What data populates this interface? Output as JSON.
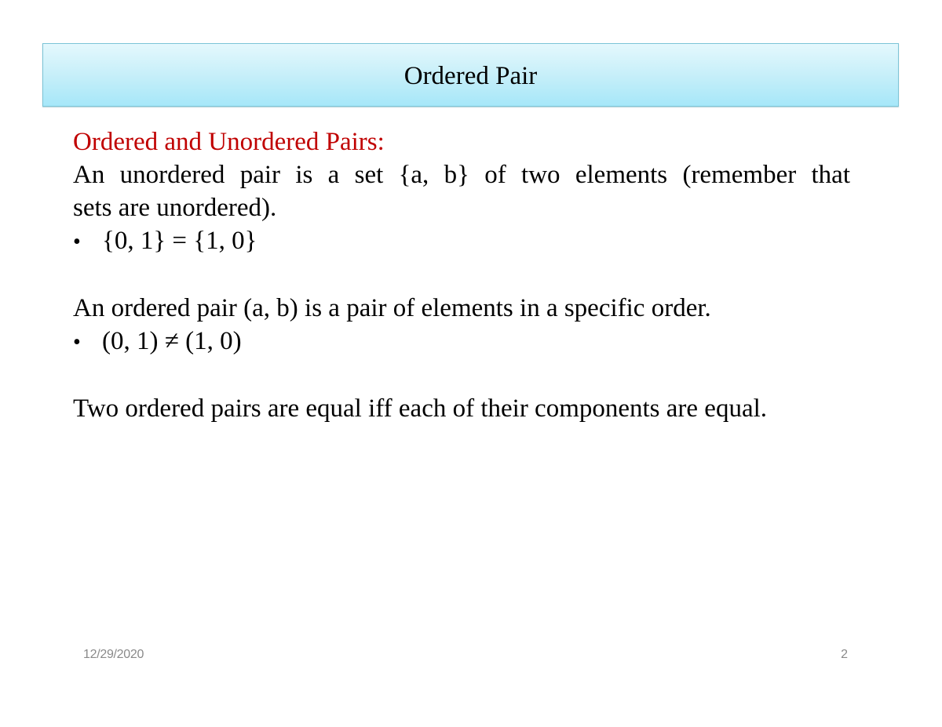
{
  "slide": {
    "title": "Ordered Pair",
    "heading": "Ordered and Unordered Pairs:",
    "paragraph1_line1": "An unordered pair is a set {a, b} of two elements (remember that",
    "paragraph1_line2": "sets are unordered).",
    "bullet1": {
      "marker": "•",
      "text": "{0, 1} = {1, 0}"
    },
    "paragraph2": "An ordered pair (a, b) is a pair of elements in a specific order.",
    "bullet2": {
      "marker": "•",
      "text": "(0, 1) ≠ (1, 0)"
    },
    "paragraph3": "Two ordered pairs are equal iff each of their components are equal."
  },
  "footer": {
    "date": "12/29/2020",
    "page_number": "2"
  },
  "colors": {
    "heading": "#c00000",
    "title_box_top": "#e4f8fd",
    "title_box_bottom": "#a6e7f9",
    "footer_text": "#8a8a8a"
  }
}
